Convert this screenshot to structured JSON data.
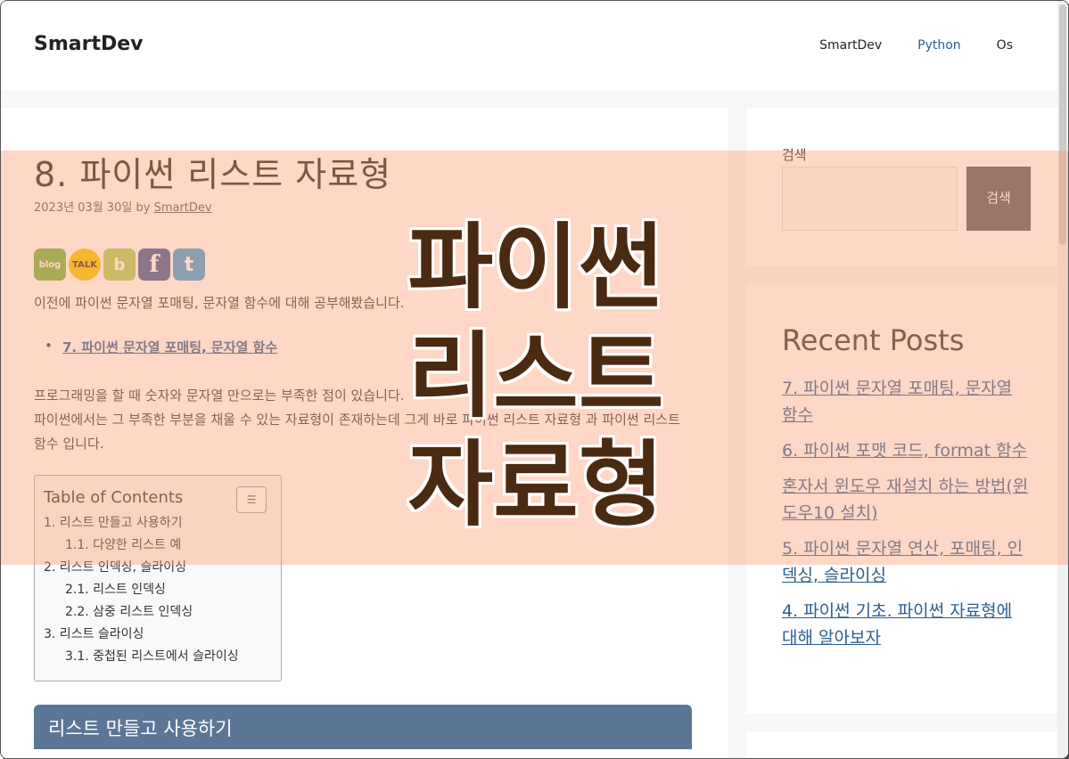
{
  "header": {
    "logo": "SmartDev",
    "nav": [
      "SmartDev",
      "Python",
      "Os"
    ]
  },
  "post": {
    "title": "8. 파이썬 리스트 자료형",
    "date": "2023년 03월 30일",
    "by": "by",
    "author": "SmartDev",
    "share_icons": [
      "blog",
      "TALK",
      "b",
      "f",
      "t"
    ],
    "intro": "이전에 파이썬 문자열 포매팅, 문자열 함수에 대해 공부해봤습니다.",
    "prev_link": "7. 파이썬 문자열 포매팅, 문자열 함수",
    "body_line1": "프로그래밍을 할 때 숫자와 문자열 만으로는 부족한 점이 있습니다.",
    "body_line2": "파이썬에서는 그 부족한 부분을 채울 수 있는 자료형이 존재하는데 그게 바로 파이썬 리스트 자료형 과 파이썬 리스트 함수 입니다.",
    "section_heading": "리스트 만들고 사용하기"
  },
  "toc": {
    "title": "Table of Contents",
    "items": [
      {
        "label": "1. 리스트 만들고 사용하기",
        "level": 1
      },
      {
        "label": "1.1. 다양한 리스트 예",
        "level": 2
      },
      {
        "label": "2. 리스트 인덱싱, 슬라이싱",
        "level": 1
      },
      {
        "label": "2.1. 리스트 인덱싱",
        "level": 2
      },
      {
        "label": "2.2. 삼중 리스트 인덱싱",
        "level": 2
      },
      {
        "label": "3. 리스트 슬라이싱",
        "level": 1
      },
      {
        "label": "3.1. 중첩된 리스트에서 슬라이싱",
        "level": 2
      }
    ]
  },
  "sidebar": {
    "search_label": "검색",
    "search_placeholder": "",
    "search_button": "검색",
    "recent_title": "Recent Posts",
    "recent_posts": [
      "7. 파이썬 문자열 포매팅, 문자열 함수",
      "6. 파이썬 포맷 코드, format 함수",
      "혼자서 윈도우 재설치 하는 방법(윈도우10 설치)",
      "5. 파이썬 문자열 연산, 포매팅, 인덱싱, 슬라이싱",
      "4. 파이썬 기초. 파이썬 자료형에 대해 알아보자"
    ]
  },
  "overlay": {
    "lines": [
      "파이썬",
      "리스트",
      "자료형"
    ]
  },
  "colors": {
    "overlay": "#ffa078",
    "link": "#2c5e8f",
    "section_bg": "#5b7697",
    "search_button_bg": "#55555e"
  }
}
